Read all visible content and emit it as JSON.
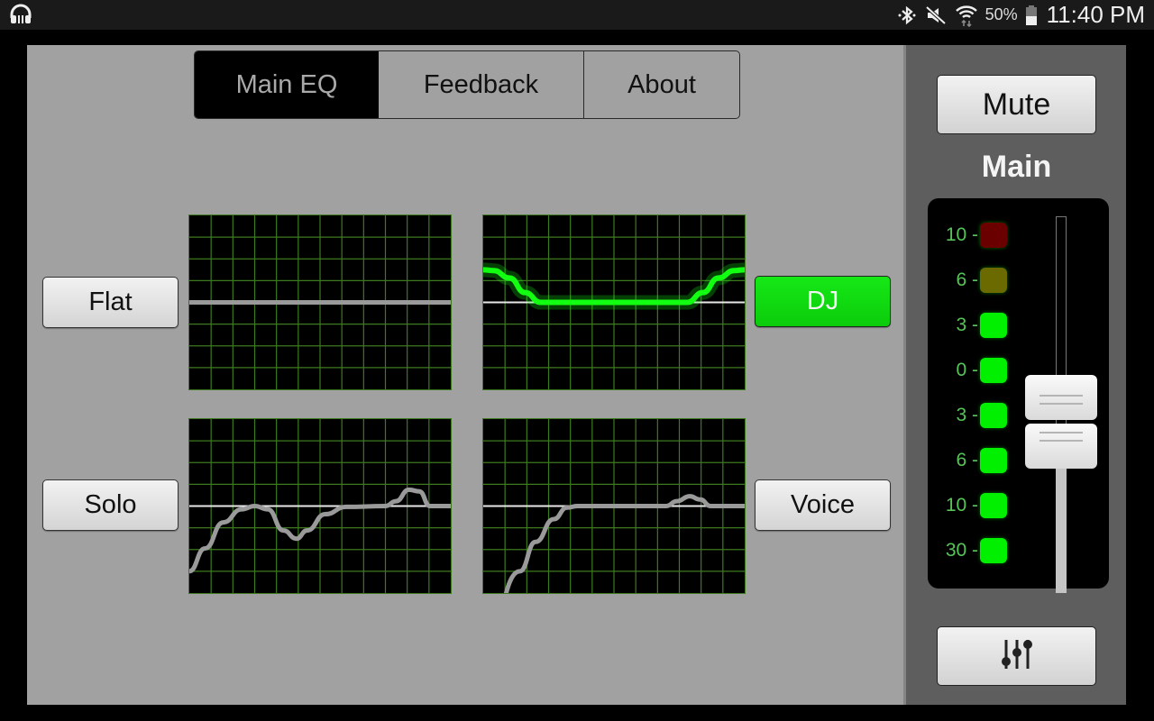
{
  "status_bar": {
    "left_icon": "headphones-icon",
    "icons": [
      "bluetooth-icon",
      "mute-sound-icon",
      "wifi-icon"
    ],
    "battery_percent": "50%",
    "battery_level": 0.5,
    "time": "11:40 PM"
  },
  "tabs": [
    {
      "label": "Main EQ",
      "active": true
    },
    {
      "label": "Feedback",
      "active": false
    },
    {
      "label": "About",
      "active": false
    }
  ],
  "presets": [
    {
      "label": "Flat",
      "active": false
    },
    {
      "label": "DJ",
      "active": true
    },
    {
      "label": "Solo",
      "active": false
    },
    {
      "label": "Voice",
      "active": false
    }
  ],
  "eq_curves": {
    "flat": {
      "points": [
        [
          0,
          0
        ],
        [
          1,
          0
        ]
      ]
    },
    "dj": {
      "points": [
        [
          0,
          2
        ],
        [
          0.04,
          1.95
        ],
        [
          0.1,
          1.5
        ],
        [
          0.16,
          0.6
        ],
        [
          0.22,
          0
        ],
        [
          0.78,
          0
        ],
        [
          0.84,
          0.6
        ],
        [
          0.9,
          1.5
        ],
        [
          0.96,
          1.95
        ],
        [
          1,
          2
        ]
      ]
    },
    "solo": {
      "points": [
        [
          0,
          -4
        ],
        [
          0.06,
          -2.6
        ],
        [
          0.13,
          -1
        ],
        [
          0.2,
          -0.2
        ],
        [
          0.25,
          0
        ],
        [
          0.3,
          -0.2
        ],
        [
          0.36,
          -1.5
        ],
        [
          0.41,
          -2
        ],
        [
          0.45,
          -1.5
        ],
        [
          0.52,
          -0.5
        ],
        [
          0.6,
          -0.05
        ],
        [
          0.75,
          0
        ],
        [
          0.79,
          0.3
        ],
        [
          0.84,
          1
        ],
        [
          0.88,
          0.9
        ],
        [
          0.92,
          0
        ],
        [
          1,
          0
        ]
      ]
    },
    "voice": {
      "points": [
        [
          0,
          -9
        ],
        [
          0.14,
          -4
        ],
        [
          0.2,
          -2.2
        ],
        [
          0.27,
          -0.8
        ],
        [
          0.32,
          -0.1
        ],
        [
          0.36,
          0
        ],
        [
          0.7,
          0
        ],
        [
          0.74,
          0.3
        ],
        [
          0.79,
          0.6
        ],
        [
          0.83,
          0.4
        ],
        [
          0.87,
          0
        ],
        [
          1,
          0
        ]
      ]
    }
  },
  "colors": {
    "accent_green": "#0fdc0f",
    "grid_green": "#3d7a1f",
    "curve_gray": "#9a9a9a",
    "active_curve": "#12ff12"
  },
  "side_panel": {
    "mute_label": "Mute",
    "channel_label": "Main",
    "meter": [
      {
        "label": "10 -",
        "color": "#6b0000"
      },
      {
        "label": "6 -",
        "color": "#6b6a00"
      },
      {
        "label": "3 -",
        "color": "#00f000"
      },
      {
        "label": "0 -",
        "color": "#00f000"
      },
      {
        "label": "3 -",
        "color": "#00f000"
      },
      {
        "label": "6 -",
        "color": "#00f000"
      },
      {
        "label": "10 -",
        "color": "#00f000"
      },
      {
        "label": "30 -",
        "color": "#00f000"
      }
    ],
    "fader_level": 0.44,
    "settings_icon": "sliders-icon"
  }
}
